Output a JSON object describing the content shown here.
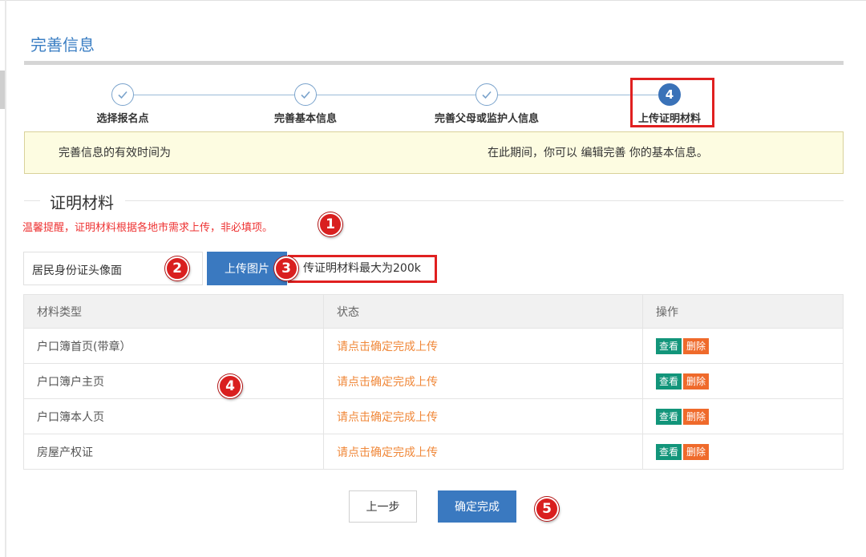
{
  "page_title": "完善信息",
  "stepper": {
    "steps": [
      {
        "label": "选择报名点",
        "state": "done"
      },
      {
        "label": "完善基本信息",
        "state": "done"
      },
      {
        "label": "完善父母或监护人信息",
        "state": "done"
      },
      {
        "label": "上传证明材料",
        "state": "active",
        "number": "4"
      }
    ]
  },
  "notice": {
    "left": "完善信息的有效时间为",
    "right": "在此期间，你可以 编辑完善 你的基本信息。"
  },
  "section": {
    "title": "证明材料",
    "warm_tip": "温馨提醒，证明材料根据各地市需求上传，非必填项。"
  },
  "upload": {
    "selected_type": "居民身份证头像面",
    "button": "上传图片",
    "size_hint": "传证明材料最大为200k"
  },
  "table": {
    "headers": [
      "材料类型",
      "状态",
      "操作"
    ],
    "rows": [
      {
        "type": "户口簿首页(带章）",
        "status": "请点击确定完成上传",
        "view": "查看",
        "delete": "删除"
      },
      {
        "type": "户口簿户主页",
        "status": "请点击确定完成上传",
        "view": "查看",
        "delete": "删除"
      },
      {
        "type": "户口簿本人页",
        "status": "请点击确定完成上传",
        "view": "查看",
        "delete": "删除"
      },
      {
        "type": "房屋产权证",
        "status": "请点击确定完成上传",
        "view": "查看",
        "delete": "删除"
      }
    ]
  },
  "footer": {
    "prev": "上一步",
    "confirm": "确定完成"
  },
  "annotations": [
    "1",
    "2",
    "3",
    "4",
    "5"
  ],
  "colors": {
    "primary": "#3a79c0",
    "tip_red": "#e33333",
    "status_orange": "#f0883a",
    "view_green": "#12957a",
    "delete_orange": "#ef6a2b",
    "notice_bg": "#fdfce1",
    "annotation_red": "#d91f1f"
  }
}
